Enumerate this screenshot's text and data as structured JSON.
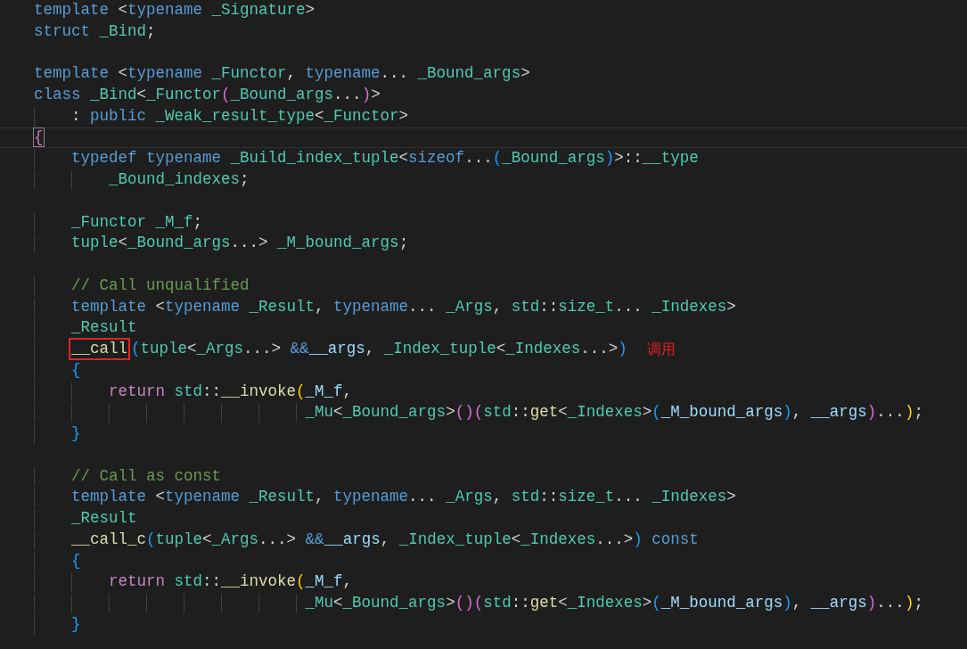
{
  "editor": {
    "lines": [
      {
        "kind": "code",
        "current": false,
        "tokens": [
          {
            "kind": "keyword",
            "text": "template"
          },
          {
            "kind": "plain",
            "text": " <"
          },
          {
            "kind": "keyword",
            "text": "typename"
          },
          {
            "kind": "type",
            "text": " _Signature"
          },
          {
            "kind": "plain",
            "text": ">"
          }
        ]
      },
      {
        "kind": "code",
        "current": false,
        "tokens": [
          {
            "kind": "keyword",
            "text": "struct"
          },
          {
            "kind": "type",
            "text": " _Bind"
          },
          {
            "kind": "plain",
            "text": ";"
          }
        ]
      },
      {
        "kind": "blank",
        "current": false
      },
      {
        "kind": "code",
        "current": false,
        "tokens": [
          {
            "kind": "keyword",
            "text": "template"
          },
          {
            "kind": "plain",
            "text": " <"
          },
          {
            "kind": "keyword",
            "text": "typename"
          },
          {
            "kind": "type",
            "text": " _Functor"
          },
          {
            "kind": "plain",
            "text": ", "
          },
          {
            "kind": "keyword",
            "text": "typename"
          },
          {
            "kind": "plain",
            "text": "... "
          },
          {
            "kind": "type",
            "text": "_Bound_args"
          },
          {
            "kind": "plain",
            "text": ">"
          }
        ]
      },
      {
        "kind": "code",
        "current": false,
        "tokens": [
          {
            "kind": "keyword",
            "text": "class"
          },
          {
            "kind": "type",
            "text": " _Bind"
          },
          {
            "kind": "plain",
            "text": "<"
          },
          {
            "kind": "type",
            "text": "_Functor"
          },
          {
            "kind": "bracket2",
            "text": "("
          },
          {
            "kind": "type",
            "text": "_Bound_args"
          },
          {
            "kind": "plain",
            "text": "..."
          },
          {
            "kind": "bracket2",
            "text": ")"
          },
          {
            "kind": "plain",
            "text": ">"
          }
        ]
      },
      {
        "kind": "code",
        "current": false,
        "tokens": [
          {
            "kind": "plain",
            "text": "    : "
          },
          {
            "kind": "keyword",
            "text": "public"
          },
          {
            "kind": "type",
            "text": " _Weak_result_type"
          },
          {
            "kind": "plain",
            "text": "<"
          },
          {
            "kind": "type",
            "text": "_Functor"
          },
          {
            "kind": "plain",
            "text": ">"
          }
        ]
      },
      {
        "kind": "code",
        "current": true,
        "tokens": [
          {
            "kind": "bracket-match",
            "text": "{"
          }
        ]
      },
      {
        "kind": "code",
        "current": false,
        "tokens": [
          {
            "kind": "keyword",
            "text": "    typedef"
          },
          {
            "kind": "keyword",
            "text": " typename"
          },
          {
            "kind": "type",
            "text": " _Build_index_tuple"
          },
          {
            "kind": "plain",
            "text": "<"
          },
          {
            "kind": "keyword",
            "text": "sizeof"
          },
          {
            "kind": "plain",
            "text": "..."
          },
          {
            "kind": "bracket3",
            "text": "("
          },
          {
            "kind": "type",
            "text": "_Bound_args"
          },
          {
            "kind": "bracket3",
            "text": ")"
          },
          {
            "kind": "plain",
            "text": ">::"
          },
          {
            "kind": "type",
            "text": "__type"
          }
        ]
      },
      {
        "kind": "code",
        "current": false,
        "tokens": [
          {
            "kind": "type",
            "text": "        _Bound_indexes"
          },
          {
            "kind": "plain",
            "text": ";"
          }
        ]
      },
      {
        "kind": "blank",
        "current": false
      },
      {
        "kind": "code",
        "current": false,
        "tokens": [
          {
            "kind": "type",
            "text": "    _Functor"
          },
          {
            "kind": "type",
            "text": " _M_f"
          },
          {
            "kind": "plain",
            "text": ";"
          }
        ]
      },
      {
        "kind": "code",
        "current": false,
        "tokens": [
          {
            "kind": "type",
            "text": "    tuple"
          },
          {
            "kind": "plain",
            "text": "<"
          },
          {
            "kind": "type",
            "text": "_Bound_args"
          },
          {
            "kind": "plain",
            "text": "...> "
          },
          {
            "kind": "type",
            "text": "_M_bound_args"
          },
          {
            "kind": "plain",
            "text": ";"
          }
        ]
      },
      {
        "kind": "blank",
        "current": false
      },
      {
        "kind": "code",
        "current": false,
        "tokens": [
          {
            "kind": "comment",
            "text": "    // Call unqualified"
          }
        ]
      },
      {
        "kind": "code",
        "current": false,
        "tokens": [
          {
            "kind": "keyword",
            "text": "    template"
          },
          {
            "kind": "plain",
            "text": " <"
          },
          {
            "kind": "keyword",
            "text": "typename"
          },
          {
            "kind": "type",
            "text": " _Result"
          },
          {
            "kind": "plain",
            "text": ", "
          },
          {
            "kind": "keyword",
            "text": "typename"
          },
          {
            "kind": "plain",
            "text": "... "
          },
          {
            "kind": "type",
            "text": "_Args"
          },
          {
            "kind": "plain",
            "text": ", "
          },
          {
            "kind": "type",
            "text": "std"
          },
          {
            "kind": "plain",
            "text": "::"
          },
          {
            "kind": "type",
            "text": "size_t"
          },
          {
            "kind": "plain",
            "text": "... "
          },
          {
            "kind": "type",
            "text": "_Indexes"
          },
          {
            "kind": "plain",
            "text": ">"
          }
        ]
      },
      {
        "kind": "code",
        "current": false,
        "tokens": [
          {
            "kind": "type",
            "text": "    _Result"
          }
        ]
      },
      {
        "kind": "code",
        "current": false,
        "note": "调用",
        "tokens": [
          {
            "kind": "annotated",
            "text": "    __call"
          },
          {
            "kind": "bracket3",
            "text": "("
          },
          {
            "kind": "type",
            "text": "tuple"
          },
          {
            "kind": "plain",
            "text": "<"
          },
          {
            "kind": "type",
            "text": "_Args"
          },
          {
            "kind": "plain",
            "text": "...> "
          },
          {
            "kind": "keyword",
            "text": "&&"
          },
          {
            "kind": "variable",
            "text": "__args"
          },
          {
            "kind": "plain",
            "text": ", "
          },
          {
            "kind": "type",
            "text": "_Index_tuple"
          },
          {
            "kind": "plain",
            "text": "<"
          },
          {
            "kind": "type",
            "text": "_Indexes"
          },
          {
            "kind": "plain",
            "text": "...>"
          },
          {
            "kind": "bracket3",
            "text": ")"
          }
        ]
      },
      {
        "kind": "code",
        "current": false,
        "tokens": [
          {
            "kind": "bracket3",
            "text": "    {"
          }
        ]
      },
      {
        "kind": "code",
        "current": false,
        "tokens": [
          {
            "kind": "control",
            "text": "        return"
          },
          {
            "kind": "type",
            "text": " std"
          },
          {
            "kind": "plain",
            "text": "::"
          },
          {
            "kind": "function",
            "text": "__invoke"
          },
          {
            "kind": "bracket1",
            "text": "("
          },
          {
            "kind": "variable",
            "text": "_M_f"
          },
          {
            "kind": "plain",
            "text": ","
          }
        ]
      },
      {
        "kind": "code",
        "current": false,
        "tokens": [
          {
            "kind": "type",
            "text": "                             _Mu"
          },
          {
            "kind": "plain",
            "text": "<"
          },
          {
            "kind": "type",
            "text": "_Bound_args"
          },
          {
            "kind": "plain",
            "text": ">"
          },
          {
            "kind": "bracket2",
            "text": "()("
          },
          {
            "kind": "type",
            "text": "std"
          },
          {
            "kind": "plain",
            "text": "::"
          },
          {
            "kind": "function",
            "text": "get"
          },
          {
            "kind": "plain",
            "text": "<"
          },
          {
            "kind": "type",
            "text": "_Indexes"
          },
          {
            "kind": "plain",
            "text": ">"
          },
          {
            "kind": "bracket3",
            "text": "("
          },
          {
            "kind": "variable",
            "text": "_M_bound_args"
          },
          {
            "kind": "bracket3",
            "text": ")"
          },
          {
            "kind": "plain",
            "text": ", "
          },
          {
            "kind": "variable",
            "text": "__args"
          },
          {
            "kind": "bracket2",
            "text": ")"
          },
          {
            "kind": "plain",
            "text": "..."
          },
          {
            "kind": "bracket1",
            "text": ")"
          },
          {
            "kind": "plain",
            "text": ";"
          }
        ]
      },
      {
        "kind": "code",
        "current": false,
        "tokens": [
          {
            "kind": "bracket3",
            "text": "    }"
          }
        ]
      },
      {
        "kind": "blank",
        "current": false
      },
      {
        "kind": "code",
        "current": false,
        "tokens": [
          {
            "kind": "comment",
            "text": "    // Call as const"
          }
        ]
      },
      {
        "kind": "code",
        "current": false,
        "tokens": [
          {
            "kind": "keyword",
            "text": "    template"
          },
          {
            "kind": "plain",
            "text": " <"
          },
          {
            "kind": "keyword",
            "text": "typename"
          },
          {
            "kind": "type",
            "text": " _Result"
          },
          {
            "kind": "plain",
            "text": ", "
          },
          {
            "kind": "keyword",
            "text": "typename"
          },
          {
            "kind": "plain",
            "text": "... "
          },
          {
            "kind": "type",
            "text": "_Args"
          },
          {
            "kind": "plain",
            "text": ", "
          },
          {
            "kind": "type",
            "text": "std"
          },
          {
            "kind": "plain",
            "text": "::"
          },
          {
            "kind": "type",
            "text": "size_t"
          },
          {
            "kind": "plain",
            "text": "... "
          },
          {
            "kind": "type",
            "text": "_Indexes"
          },
          {
            "kind": "plain",
            "text": ">"
          }
        ]
      },
      {
        "kind": "code",
        "current": false,
        "tokens": [
          {
            "kind": "type",
            "text": "    _Result"
          }
        ]
      },
      {
        "kind": "code",
        "current": false,
        "tokens": [
          {
            "kind": "function",
            "text": "    __call_c"
          },
          {
            "kind": "bracket3",
            "text": "("
          },
          {
            "kind": "type",
            "text": "tuple"
          },
          {
            "kind": "plain",
            "text": "<"
          },
          {
            "kind": "type",
            "text": "_Args"
          },
          {
            "kind": "plain",
            "text": "...> "
          },
          {
            "kind": "keyword",
            "text": "&&"
          },
          {
            "kind": "variable",
            "text": "__args"
          },
          {
            "kind": "plain",
            "text": ", "
          },
          {
            "kind": "type",
            "text": "_Index_tuple"
          },
          {
            "kind": "plain",
            "text": "<"
          },
          {
            "kind": "type",
            "text": "_Indexes"
          },
          {
            "kind": "plain",
            "text": "...>"
          },
          {
            "kind": "bracket3",
            "text": ")"
          },
          {
            "kind": "keyword",
            "text": " const"
          }
        ]
      },
      {
        "kind": "code",
        "current": false,
        "tokens": [
          {
            "kind": "bracket3",
            "text": "    {"
          }
        ]
      },
      {
        "kind": "code",
        "current": false,
        "tokens": [
          {
            "kind": "control",
            "text": "        return"
          },
          {
            "kind": "type",
            "text": " std"
          },
          {
            "kind": "plain",
            "text": "::"
          },
          {
            "kind": "function",
            "text": "__invoke"
          },
          {
            "kind": "bracket1",
            "text": "("
          },
          {
            "kind": "variable",
            "text": "_M_f"
          },
          {
            "kind": "plain",
            "text": ","
          }
        ]
      },
      {
        "kind": "code",
        "current": false,
        "tokens": [
          {
            "kind": "type",
            "text": "                             _Mu"
          },
          {
            "kind": "plain",
            "text": "<"
          },
          {
            "kind": "type",
            "text": "_Bound_args"
          },
          {
            "kind": "plain",
            "text": ">"
          },
          {
            "kind": "bracket2",
            "text": "()("
          },
          {
            "kind": "type",
            "text": "std"
          },
          {
            "kind": "plain",
            "text": "::"
          },
          {
            "kind": "function",
            "text": "get"
          },
          {
            "kind": "plain",
            "text": "<"
          },
          {
            "kind": "type",
            "text": "_Indexes"
          },
          {
            "kind": "plain",
            "text": ">"
          },
          {
            "kind": "bracket3",
            "text": "("
          },
          {
            "kind": "variable",
            "text": "_M_bound_args"
          },
          {
            "kind": "bracket3",
            "text": ")"
          },
          {
            "kind": "plain",
            "text": ", "
          },
          {
            "kind": "variable",
            "text": "__args"
          },
          {
            "kind": "bracket2",
            "text": ")"
          },
          {
            "kind": "plain",
            "text": "..."
          },
          {
            "kind": "bracket1",
            "text": ")"
          },
          {
            "kind": "plain",
            "text": ";"
          }
        ]
      },
      {
        "kind": "code",
        "current": false,
        "tokens": [
          {
            "kind": "bracket3",
            "text": "    }"
          }
        ]
      }
    ]
  }
}
